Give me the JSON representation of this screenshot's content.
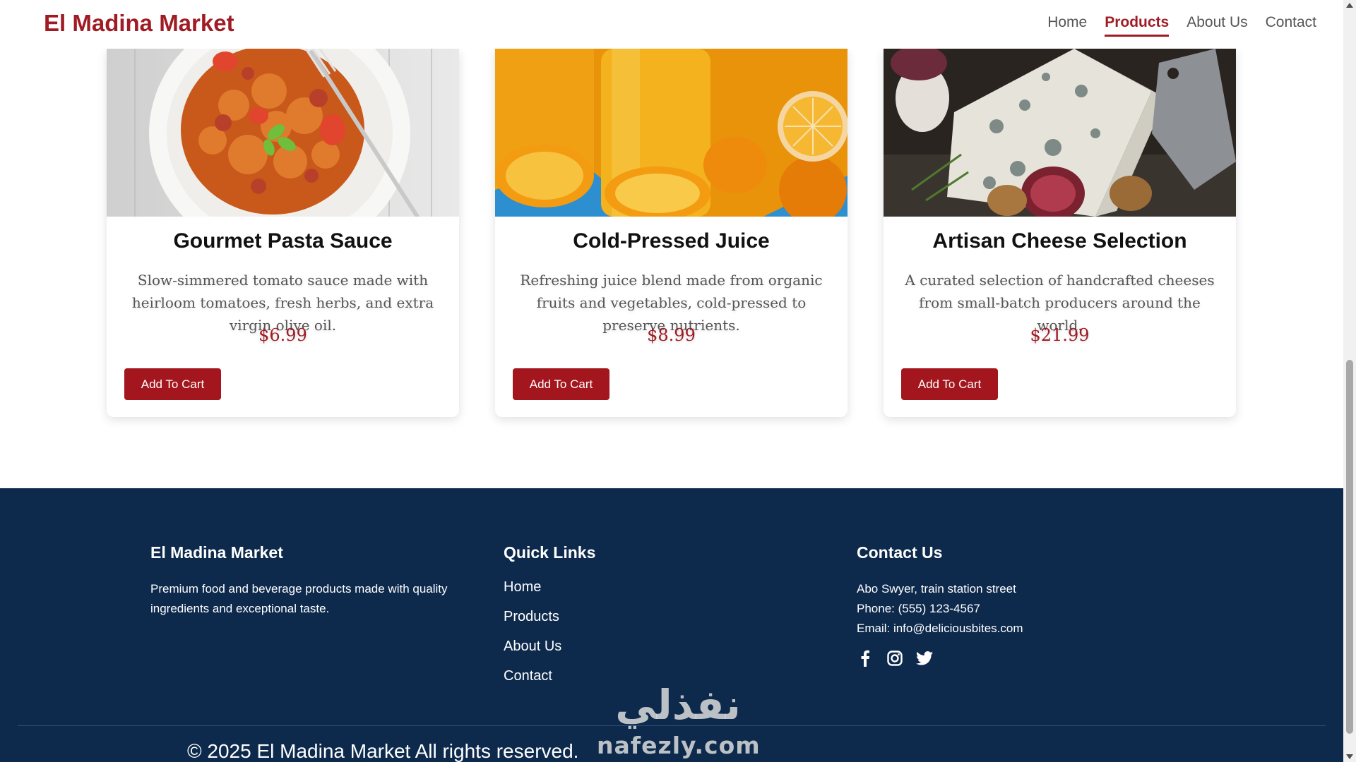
{
  "header": {
    "brand": "El Madina Market",
    "nav": [
      {
        "label": "Home",
        "active": false
      },
      {
        "label": "Products",
        "active": true
      },
      {
        "label": "About Us",
        "active": false
      },
      {
        "label": "Contact",
        "active": false
      }
    ]
  },
  "products": [
    {
      "image": "pasta-plate-image",
      "title": "Gourmet Pasta Sauce",
      "description": "Slow-simmered tomato sauce made with heirloom tomatoes, fresh herbs, and extra virgin olive oil.",
      "price": "$6.99",
      "button": "Add To Cart"
    },
    {
      "image": "orange-juice-image",
      "title": "Cold-Pressed Juice",
      "description": "Refreshing juice blend made from organic fruits and vegetables, cold-pressed to preserve nutrients.",
      "price": "$8.99",
      "button": "Add To Cart"
    },
    {
      "image": "cheese-board-image",
      "title": "Artisan Cheese Selection",
      "description": "A curated selection of handcrafted cheeses from small-batch producers around the world.",
      "price": "$21.99",
      "button": "Add To Cart"
    }
  ],
  "footer": {
    "about": {
      "heading": "El Madina Market",
      "text": "Premium food and beverage products made with quality ingredients and exceptional taste."
    },
    "quick_links": {
      "heading": "Quick Links",
      "items": [
        "Home",
        "Products",
        "About Us",
        "Contact"
      ]
    },
    "contact": {
      "heading": "Contact Us",
      "address": "Abo Swyer, train station street",
      "phone": "Phone: (555) 123-4567",
      "email": "Email: info@deliciousbites.com",
      "social": [
        "facebook-icon",
        "instagram-icon",
        "twitter-icon"
      ]
    },
    "copyright": "© 2025 El Madina Market All rights reserved."
  },
  "watermark": {
    "arabic": "نفذلي",
    "latin": "nafezly.com"
  },
  "colors": {
    "brand": "#a01c24",
    "button": "#a3161d",
    "footer_bg": "#0d2a4c"
  }
}
